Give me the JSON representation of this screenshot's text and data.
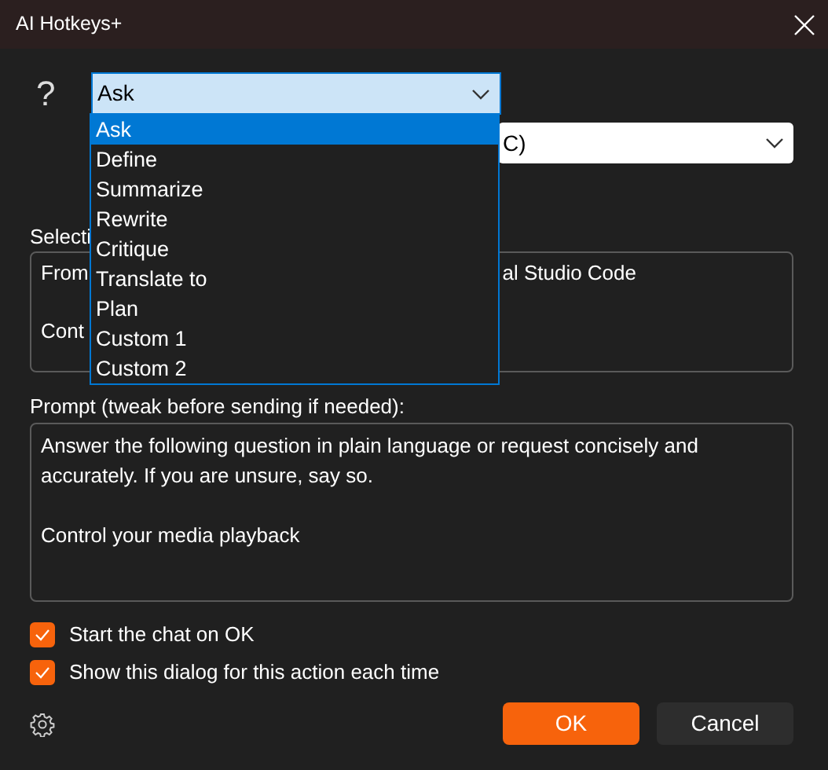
{
  "window": {
    "title": "AI Hotkeys+"
  },
  "action_icon": "?",
  "action_combo": {
    "value": "Ask",
    "expanded": true
  },
  "action_list": [
    {
      "label": "Ask",
      "selected": true
    },
    {
      "label": "Define",
      "selected": false
    },
    {
      "label": "Summarize",
      "selected": false
    },
    {
      "label": "Rewrite",
      "selected": false
    },
    {
      "label": "Critique",
      "selected": false
    },
    {
      "label": "Translate to",
      "selected": false
    },
    {
      "label": "Plan",
      "selected": false
    },
    {
      "label": "Custom 1",
      "selected": false
    },
    {
      "label": "Custom 2",
      "selected": false
    }
  ],
  "second_combo": {
    "value": "C)"
  },
  "selection": {
    "label": "Selecti",
    "lines": [
      {
        "left": "From",
        "right": "al Studio Code"
      },
      {
        "left": "Cont"
      }
    ]
  },
  "prompt": {
    "label": "Prompt (tweak before sending if needed):",
    "value": "Answer the following question in plain language or request concisely and accurately. If you are unsure, say so.\n\nControl your media playback"
  },
  "options": [
    {
      "label": "Start the chat on OK",
      "checked": true
    },
    {
      "label": "Show this dialog for this action each time",
      "checked": true
    }
  ],
  "buttons": [
    {
      "label": "OK",
      "kind": "primary"
    },
    {
      "label": "Cancel",
      "kind": "secondary"
    }
  ]
}
